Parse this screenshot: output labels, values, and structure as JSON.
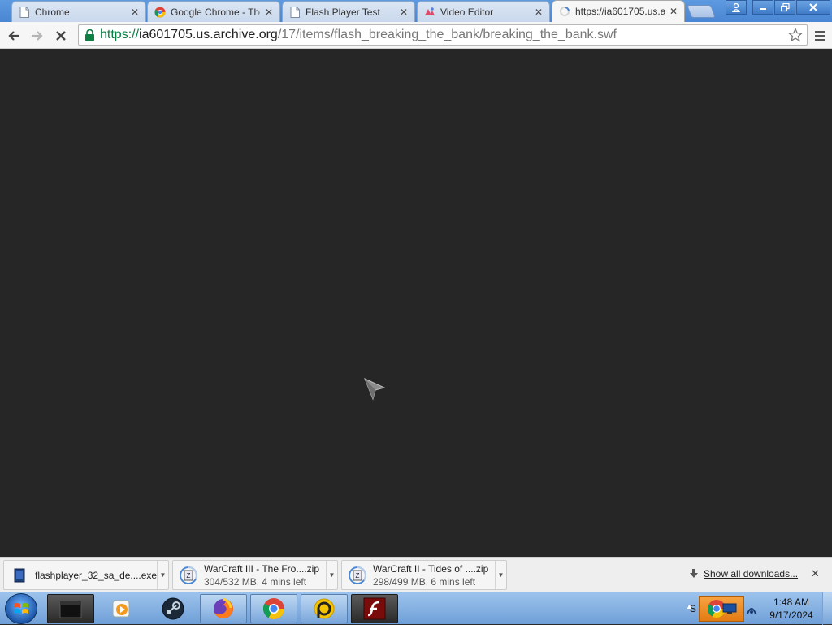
{
  "tabs": [
    {
      "title": "Chrome",
      "icon": "page-icon",
      "active": false
    },
    {
      "title": "Google Chrome - The",
      "icon": "chrome-icon",
      "active": false
    },
    {
      "title": "Flash Player Test",
      "icon": "page-icon",
      "active": false
    },
    {
      "title": "Video Editor",
      "icon": "video-editor-icon",
      "active": false
    },
    {
      "title": "https://ia601705.us.a",
      "icon": "loading-spinner-icon",
      "active": true
    }
  ],
  "toolbar": {
    "back": "back-arrow-icon",
    "forward": "forward-arrow-icon",
    "stop": "stop-icon",
    "url_scheme": "https://",
    "url_host": "ia601705.us.archive.org",
    "url_path": "/17/items/flash_breaking_the_bank/breaking_the_bank.swf"
  },
  "downloads": [
    {
      "name": "flashplayer_32_sa_de....exe",
      "status": ""
    },
    {
      "name": "WarCraft III - The Fro....zip",
      "status": "304/532 MB, 4 mins left"
    },
    {
      "name": "WarCraft II - Tides of ....zip",
      "status": "298/499 MB, 6 mins left"
    }
  ],
  "shelf": {
    "show_all_label": "Show all downloads..."
  },
  "taskbar": {
    "apps": [
      "terminal-app",
      "media-player-app",
      "steam-app",
      "firefox-app",
      "chrome-app",
      "app-circle-d",
      "flash-player-app"
    ],
    "tray_letter": "S",
    "time": "1:48 AM",
    "date": "9/17/2024"
  },
  "colors": {
    "page_bg": "#262626",
    "accent": "#4a86d3",
    "url_green": "#0b8043"
  }
}
